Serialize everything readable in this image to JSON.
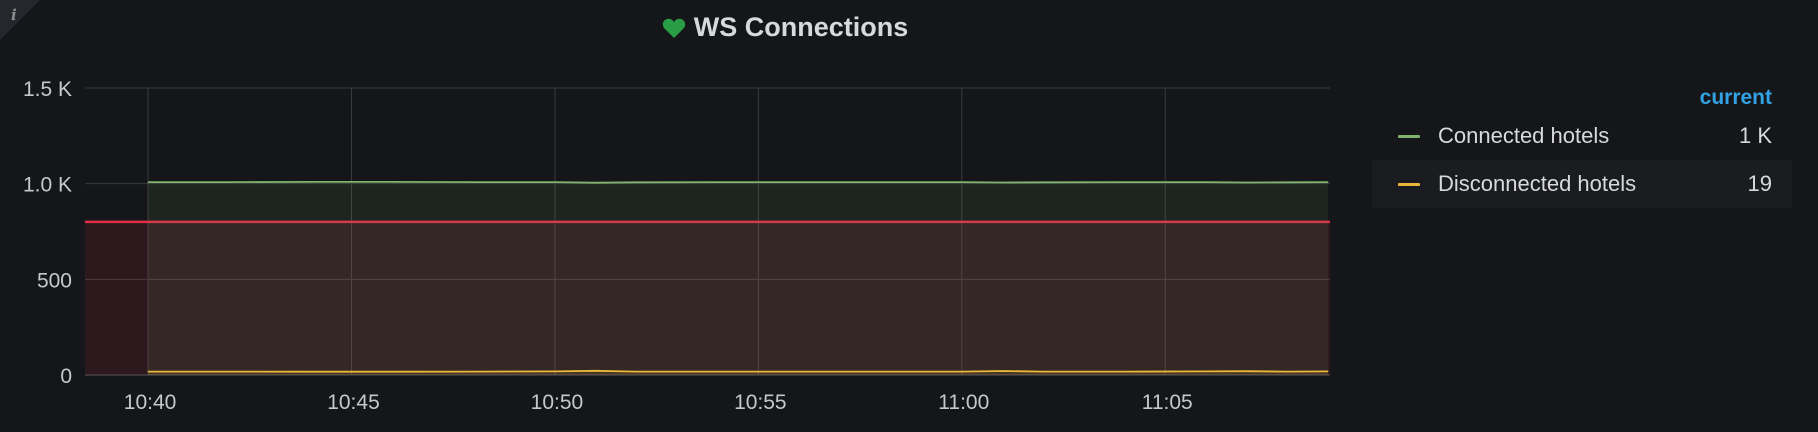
{
  "panel": {
    "title": "WS Connections",
    "status_icon": "heart-icon",
    "status_color": "#299c46",
    "info_icon": "i"
  },
  "legend": {
    "header": "current",
    "items": [
      {
        "name": "Connected hotels",
        "value": "1 K",
        "color": "#7eb26d"
      },
      {
        "name": "Disconnected hotels",
        "value": "19",
        "color": "#eab839"
      }
    ]
  },
  "chart_data": {
    "type": "line",
    "title": "WS Connections",
    "xlabel": "",
    "ylabel": "",
    "x_ticks": [
      "10:40",
      "10:45",
      "10:50",
      "10:55",
      "11:00",
      "11:05"
    ],
    "y_ticks": [
      "0",
      "500",
      "1.0 K",
      "1.5 K"
    ],
    "y_tick_values": [
      0,
      500,
      1000,
      1500
    ],
    "ylim": [
      0,
      1500
    ],
    "xlim_minutes": [
      10.66,
      11.15
    ],
    "grid": true,
    "legend_position": "right",
    "threshold": {
      "value": 800,
      "color": "#e02f44",
      "fill": "below"
    },
    "series": [
      {
        "name": "Connected hotels",
        "color": "#7eb26d",
        "x": [
          "10:40",
          "10:42",
          "10:44",
          "10:46",
          "10:48",
          "10:50",
          "10:51",
          "10:52",
          "10:54",
          "10:56",
          "10:58",
          "11:00",
          "11:01",
          "11:02",
          "11:04",
          "11:06",
          "11:07",
          "11:08",
          "11:09"
        ],
        "values": [
          1008,
          1008,
          1009,
          1009,
          1008,
          1008,
          1005,
          1007,
          1008,
          1008,
          1008,
          1008,
          1006,
          1007,
          1008,
          1008,
          1006,
          1007,
          1008
        ]
      },
      {
        "name": "Disconnected hotels",
        "color": "#eab839",
        "x": [
          "10:40",
          "10:42",
          "10:44",
          "10:46",
          "10:48",
          "10:50",
          "10:51",
          "10:52",
          "10:54",
          "10:56",
          "10:58",
          "11:00",
          "11:01",
          "11:02",
          "11:04",
          "11:06",
          "11:07",
          "11:08",
          "11:09"
        ],
        "values": [
          18,
          18,
          17,
          17,
          18,
          19,
          22,
          18,
          18,
          18,
          18,
          18,
          21,
          18,
          18,
          19,
          20,
          18,
          19
        ]
      }
    ]
  }
}
